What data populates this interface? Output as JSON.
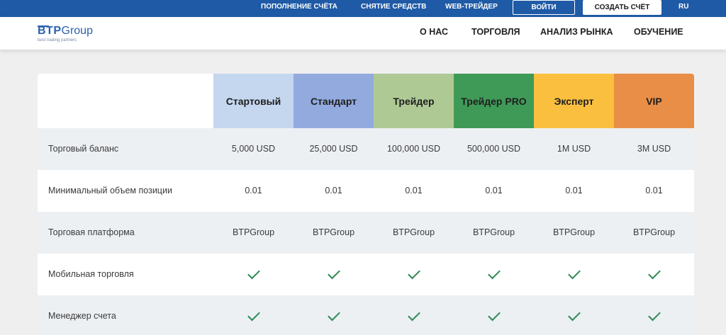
{
  "topbar": {
    "links": [
      "ПОПОЛНЕНИЕ СЧЁТА",
      "СНЯТИЕ СРЕДСТВ",
      "WEB-ТРЕЙДЕР"
    ],
    "login_label": "ВОЙТИ",
    "create_label": "СОЗДАТЬ СЧЁТ",
    "lang": "RU"
  },
  "logo": {
    "bt": "BTP",
    "group": "Group",
    "tagline": "best trading partners"
  },
  "nav": [
    "О НАС",
    "ТОРГОВЛЯ",
    "АНАЛИЗ РЫНКА",
    "ОБУЧЕНИЕ"
  ],
  "plans": [
    {
      "name": "Стартовый",
      "color": "#c5d6ef"
    },
    {
      "name": "Стандарт",
      "color": "#93aadf"
    },
    {
      "name": "Трейдер",
      "color": "#afc995"
    },
    {
      "name": "Трейдер PRO",
      "color": "#3f9a57"
    },
    {
      "name": "Эксперт",
      "color": "#fbbf3f"
    },
    {
      "name": "VIP",
      "color": "#e98e46"
    }
  ],
  "rows": [
    {
      "label": "Торговый баланс",
      "values": [
        "5,000 USD",
        "25,000 USD",
        "100,000 USD",
        "500,000 USD",
        "1M USD",
        "3M USD"
      ]
    },
    {
      "label": "Минимальный объем позиции",
      "values": [
        "0.01",
        "0.01",
        "0.01",
        "0.01",
        "0.01",
        "0.01"
      ]
    },
    {
      "label": "Торговая платформа",
      "values": [
        "BTPGroup",
        "BTPGroup",
        "BTPGroup",
        "BTPGroup",
        "BTPGroup",
        "BTPGroup"
      ]
    },
    {
      "label": "Мобильная торговля",
      "checks": [
        true,
        true,
        true,
        true,
        true,
        true
      ]
    },
    {
      "label": "Менеджер счета",
      "checks": [
        true,
        true,
        true,
        true,
        true,
        true
      ]
    }
  ],
  "colors": {
    "topbar": "#1f5aa6",
    "check": "#2e8b57"
  }
}
